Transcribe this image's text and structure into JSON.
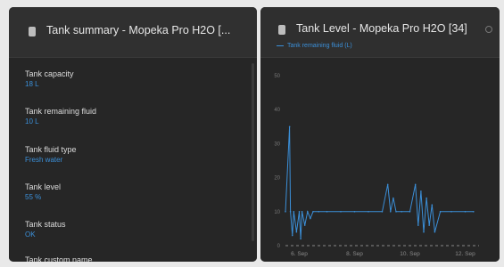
{
  "colors": {
    "accent": "#3b8fd8",
    "panel_bg": "#2b2b2b",
    "text": "#e6e6e6"
  },
  "left_panel": {
    "icon": "tank-icon",
    "title": "Tank summary - Mopeka Pro H2O [...",
    "items": [
      {
        "label": "Tank capacity",
        "value": "18 L"
      },
      {
        "label": "Tank remaining fluid",
        "value": "10 L"
      },
      {
        "label": "Tank fluid type",
        "value": "Fresh water"
      },
      {
        "label": "Tank level",
        "value": "55 %"
      },
      {
        "label": "Tank status",
        "value": "OK"
      },
      {
        "label": "Tank custom name",
        "value": ""
      }
    ]
  },
  "right_panel": {
    "icon": "tank-icon",
    "title": "Tank Level - Mopeka Pro H2O [34]",
    "settings_icon": "gear-icon",
    "legend": "Tank remaining fluid (L)"
  },
  "chart_data": {
    "type": "line",
    "title": "Tank Level - Mopeka Pro H2O [34]",
    "ylim": [
      0,
      50
    ],
    "yticks": [
      "0",
      "10",
      "20",
      "30",
      "40",
      "50"
    ],
    "xticks": [
      "6. Sep",
      "8. Sep",
      "10. Sep",
      "12. Sep"
    ],
    "series": [
      {
        "name": "Tank remaining fluid (L)",
        "x": [
          0.0,
          0.15,
          0.18,
          0.25,
          0.3,
          0.4,
          0.5,
          0.55,
          0.6,
          0.7,
          0.8,
          0.9,
          1.0,
          1.2,
          1.5,
          2.0,
          2.5,
          3.0,
          3.5,
          3.7,
          3.8,
          3.9,
          4.0,
          4.2,
          4.5,
          4.7,
          4.8,
          4.9,
          5.0,
          5.1,
          5.2,
          5.3,
          5.4,
          5.6,
          6.0,
          6.5,
          6.8
        ],
        "values": [
          10,
          35,
          10,
          3,
          10,
          4,
          10,
          2,
          10,
          6,
          10,
          8,
          10,
          10,
          10,
          10,
          10,
          10,
          10,
          18,
          10,
          14,
          10,
          10,
          10,
          18,
          6,
          16,
          4,
          14,
          6,
          12,
          4,
          10,
          10,
          10,
          10
        ]
      }
    ]
  }
}
